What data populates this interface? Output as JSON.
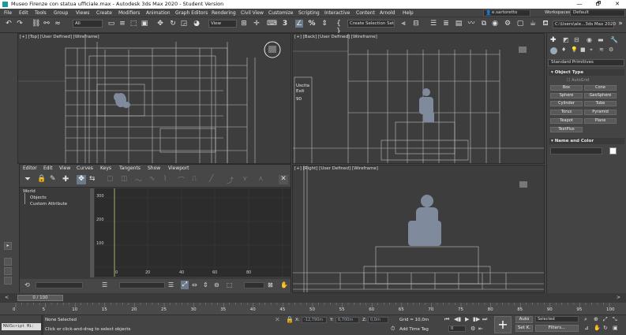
{
  "window": {
    "title": "Museo Firenze con statua ufficiale.max - Autodesk 3ds Max 2020 - Student Version",
    "controls": [
      "—",
      "🗗",
      "✕"
    ]
  },
  "menu": [
    "File",
    "Edit",
    "Tools",
    "Group",
    "Views",
    "Create",
    "Modifiers",
    "Animation",
    "Graph Editors",
    "Rendering",
    "Civil View",
    "Customize",
    "Scripting",
    "Interactive",
    "Content",
    "Arnold",
    "Help"
  ],
  "user": {
    "name": "e.sartoretto",
    "workspace_label": "Workspaces:",
    "workspace_value": "Default"
  },
  "toolbar": {
    "filter_value": "All",
    "coord_value": "View",
    "snap_label": "3",
    "percent_label": "%",
    "selection_set_value": "Create Selection Set",
    "path_value": "C:\\Users\\ale...3ds Max 2020"
  },
  "viewports": {
    "top": {
      "label": "[+] [Top] [User Defined] [Wireframe]"
    },
    "back": {
      "label": "[+] [Back] [User Defined] [Wireframe]",
      "exit_sign": [
        "Uscita",
        "Exit",
        "90"
      ]
    },
    "right": {
      "label": "[+] [Right] [User Defined] [Wireframe]"
    }
  },
  "curve_editor": {
    "menu": [
      "Editor",
      "Edit",
      "View",
      "Curves",
      "Keys",
      "Tangents",
      "Show",
      "Viewport"
    ],
    "tree": [
      "World",
      "Objects",
      "Custom Attribute"
    ],
    "y_ticks": [
      "300",
      "200",
      "100"
    ],
    "x_ticks": [
      "0",
      "20",
      "40",
      "60",
      "80"
    ]
  },
  "command_panel": {
    "dropdown_value": "Standard Primitives",
    "object_type_title": "Object Type",
    "autogrid_label": "AutoGrid",
    "buttons": [
      "Box",
      "Cone",
      "Sphere",
      "GeoSphere",
      "Cylinder",
      "Tube",
      "Torus",
      "Pyramid",
      "Teapot",
      "Plane",
      "TextPlus"
    ],
    "name_color_title": "Name and Color"
  },
  "timeline": {
    "frame_display": "0 / 100",
    "ticks": [
      "0",
      "5",
      "10",
      "15",
      "20",
      "25",
      "30",
      "35",
      "40",
      "45",
      "50",
      "55",
      "60",
      "65",
      "70",
      "75",
      "80",
      "85",
      "90",
      "95",
      "100"
    ]
  },
  "status": {
    "maxscript_label": "MAXScript Mi:",
    "none_selected": "None Selected",
    "prompt": "Click or click-and-drag to select objects",
    "x_label": "X:",
    "y_label": "Y:",
    "z_label": "Z:",
    "x_value": "-12,790m",
    "y_value": "6,700m",
    "z_value": "0,0m",
    "grid_text": "Grid = 10,0m",
    "add_time_tag": "Add Time Tag",
    "auto_label": "Auto",
    "set_k_label": "Set K.",
    "selected_value": "Selected",
    "filters_label": "Filters...",
    "frame_value": "0"
  },
  "colors": {
    "background": "#444444",
    "viewport": "#3d3d3d",
    "wire": "#d8d8d8",
    "statue": "#7f8a9c",
    "accent_active": "#6a7a8a"
  }
}
